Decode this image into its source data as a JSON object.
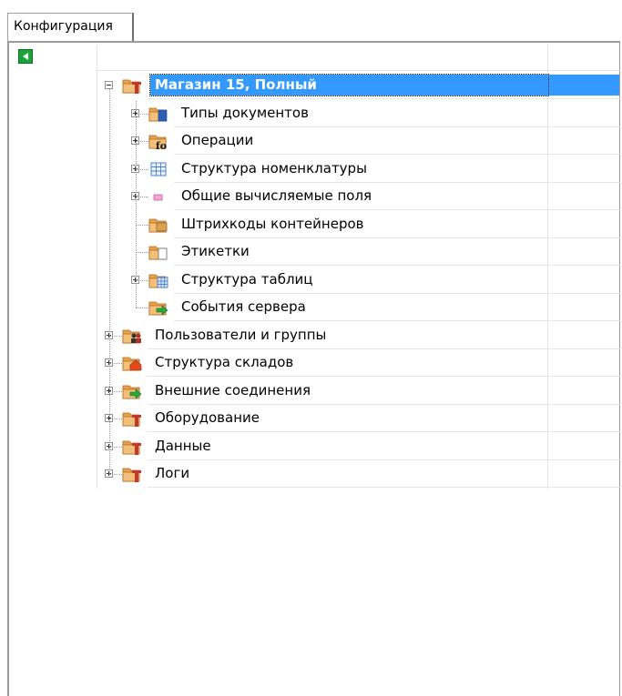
{
  "tab": {
    "label": "Конфигурация"
  },
  "tree": {
    "root": {
      "label": "Магазин 15, Полный",
      "selected": true,
      "icon": "folder-tool-icon"
    },
    "children": [
      {
        "label": "Типы документов",
        "icon": "folder-document-icon",
        "expandable": true
      },
      {
        "label": "Операции",
        "icon": "folder-fo-icon",
        "expandable": true
      },
      {
        "label": "Структура номенклатуры",
        "icon": "table-grid-icon",
        "expandable": true
      },
      {
        "label": "Общие вычисляемые поля",
        "icon": "pink-field-icon",
        "expandable": true
      },
      {
        "label": "Штрихкоды контейнеров",
        "icon": "folder-box-icon",
        "expandable": false
      },
      {
        "label": "Этикетки",
        "icon": "folder-label-icon",
        "expandable": false
      },
      {
        "label": "Структура таблиц",
        "icon": "folder-table-icon",
        "expandable": true
      },
      {
        "label": "События сервера",
        "icon": "folder-arrow-icon",
        "expandable": false
      }
    ],
    "top_level": [
      {
        "label": "Пользователи и группы",
        "icon": "folder-users-icon"
      },
      {
        "label": "Структура складов",
        "icon": "folder-warehouse-icon"
      },
      {
        "label": "Внешние соединения",
        "icon": "folder-arrow-icon"
      },
      {
        "label": "Оборудование",
        "icon": "folder-tool-icon"
      },
      {
        "label": "Данные",
        "icon": "folder-tool-icon"
      },
      {
        "label": "Логи",
        "icon": "folder-tool-icon"
      }
    ]
  },
  "colors": {
    "selection": "#3399ff",
    "folder": "#e8a24a",
    "folder_dark": "#c8641e",
    "accent_red": "#c0392b"
  }
}
